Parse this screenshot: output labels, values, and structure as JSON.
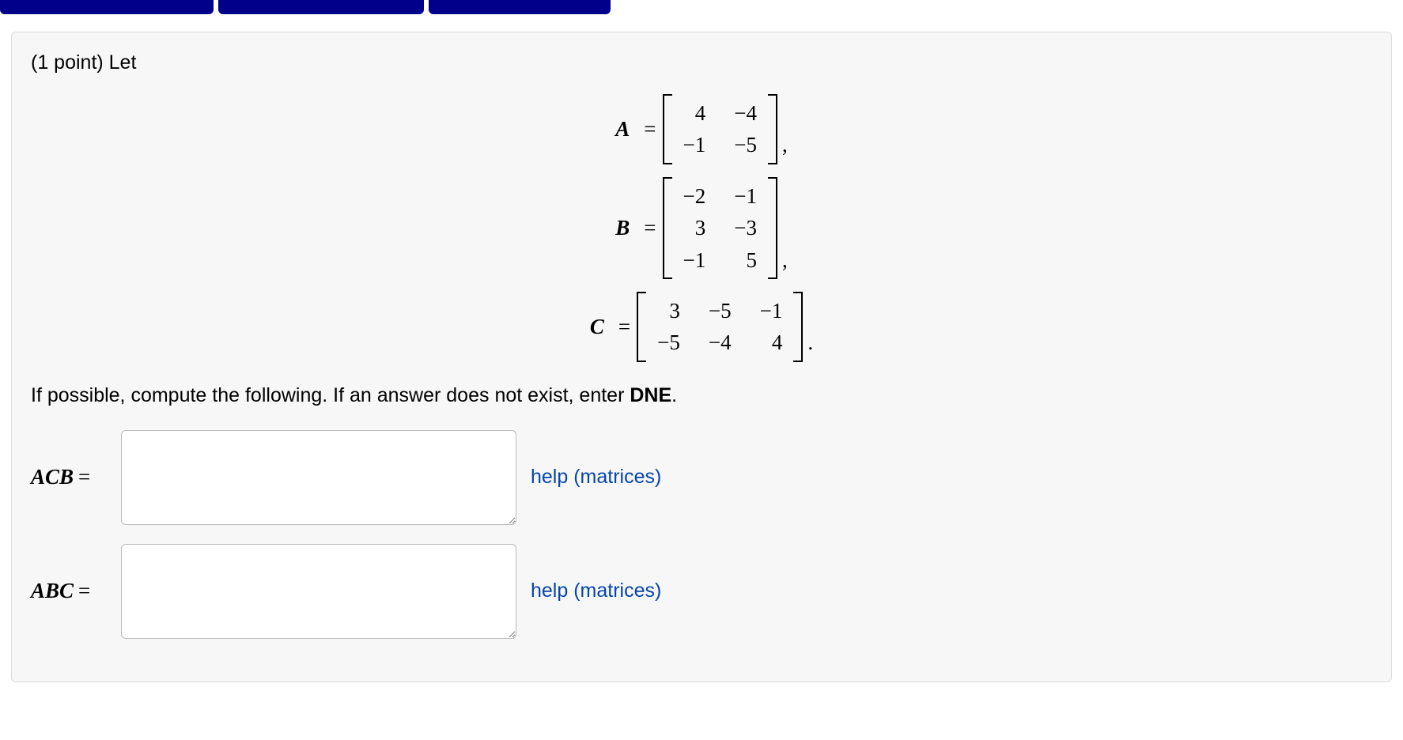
{
  "problem": {
    "points_prefix": "(1 point) Let",
    "instruction_prefix": "If possible, compute the following. If an answer does not exist, enter ",
    "dne": "DNE",
    "period": "."
  },
  "matrices": {
    "A": {
      "label": "A",
      "rows": [
        [
          "4",
          "−4"
        ],
        [
          "−1",
          "−5"
        ]
      ],
      "trail": ","
    },
    "B": {
      "label": "B",
      "rows": [
        [
          "−2",
          "−1"
        ],
        [
          "3",
          "−3"
        ],
        [
          "−1",
          "5"
        ]
      ],
      "trail": ","
    },
    "C": {
      "label": "C",
      "rows": [
        [
          "3",
          "−5",
          "−1"
        ],
        [
          "−5",
          "−4",
          "4"
        ]
      ],
      "trail": "."
    }
  },
  "answers": {
    "acb": {
      "label": "ACB",
      "eq": "=",
      "help": "help (matrices)"
    },
    "abc": {
      "label": "ABC",
      "eq": "=",
      "help": "help (matrices)"
    }
  },
  "eq": "="
}
